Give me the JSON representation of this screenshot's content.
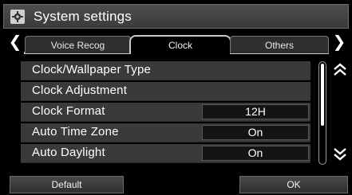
{
  "header": {
    "title": "System settings",
    "icon": "gear-icon"
  },
  "tabs": {
    "prev_icon": "chevron-left-icon",
    "next_icon": "chevron-right-icon",
    "items": [
      {
        "label": "Voice Recog",
        "active": false
      },
      {
        "label": "Clock",
        "active": true
      },
      {
        "label": "Others",
        "active": false
      }
    ]
  },
  "settings": {
    "rows": [
      {
        "label": "Clock/Wallpaper Type",
        "value": ""
      },
      {
        "label": "Clock Adjustment",
        "value": ""
      },
      {
        "label": "Clock Format",
        "value": "12H"
      },
      {
        "label": "Auto Time Zone",
        "value": "On"
      },
      {
        "label": "Auto Daylight",
        "value": "On"
      }
    ]
  },
  "scroll": {
    "up_icon": "double-chevron-up-icon",
    "down_icon": "double-chevron-down-icon"
  },
  "footer": {
    "default_label": "Default",
    "ok_label": "OK"
  }
}
